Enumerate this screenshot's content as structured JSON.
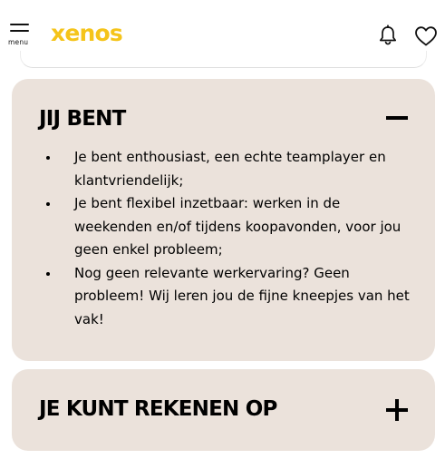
{
  "header": {
    "menu_label": "menu",
    "logo_text": "xenos",
    "brand_color": "#f5c41a",
    "icons": {
      "menu": "hamburger-icon",
      "notifications": "bell-icon",
      "favorites": "heart-icon"
    }
  },
  "sections": [
    {
      "title": "JIJ BENT",
      "expanded": true,
      "toggle_icon": "minus-icon",
      "items": [
        "Je bent enthousiast, een echte teamplayer en klantvriendelijk;",
        "Je bent flexibel inzetbaar: werken in de weekenden en/of tijdens koopavonden, voor jou geen enkel probleem;",
        "Nog geen relevante werkervaring? Geen probleem! Wij leren jou de fijne kneepjes van het vak!"
      ]
    },
    {
      "title": "JE KUNT REKENEN OP",
      "expanded": false,
      "toggle_icon": "plus-icon"
    }
  ],
  "colors": {
    "accordion_background": "#ebe2db",
    "text": "#000000"
  }
}
